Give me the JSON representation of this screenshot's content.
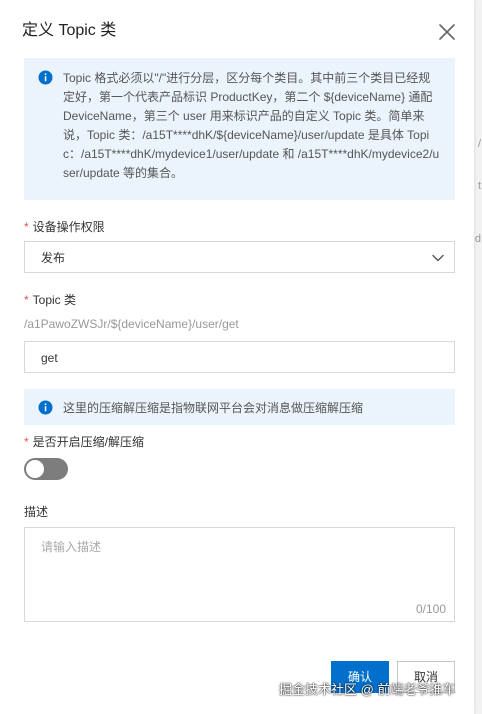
{
  "dialog": {
    "title": "定义 Topic 类"
  },
  "info_top": {
    "text": "Topic 格式必须以\"/\"进行分层，区分每个类目。其中前三个类目已经规定好，第一个代表产品标识 ProductKey，第二个 ${deviceName} 通配 DeviceName，第三个 user 用来标识产品的自定义 Topic 类。简单来说，Topic 类：/a15T****dhK/${deviceName}/user/update 是具体 Topic：/a15T****dhK/mydevice1/user/update 和 /a15T****dhK/mydevice2/user/update 等的集合。"
  },
  "permission": {
    "required_mark": "*",
    "label": "设备操作权限",
    "value": "发布"
  },
  "topic": {
    "required_mark": "*",
    "label": "Topic 类",
    "prefix_hint": "/a1PawoZWSJr/${deviceName}/user/get",
    "value": "get"
  },
  "info_mid": {
    "text": "这里的压缩解压缩是指物联网平台会对消息做压缩解压缩"
  },
  "compression": {
    "required_mark": "*",
    "label": "是否开启压缩/解压缩",
    "enabled": false
  },
  "description": {
    "label": "描述",
    "placeholder": "请输入描述",
    "counter": "0/100"
  },
  "footer": {
    "confirm_label": "确认",
    "cancel_label": "取消"
  },
  "watermark": {
    "text": "掘金技术社区 @ 前端老爷推车"
  },
  "background": {
    "glyph_1": "/",
    "glyph_2": "t",
    "glyph_3": "d"
  },
  "colors": {
    "primary": "#0070cc",
    "info_bg": "#ebf4fd",
    "info_icon": "#0070cc",
    "required": "#e8524a",
    "toggle_off": "#7d7d7d"
  },
  "icons": {
    "close": "close-icon",
    "info": "info-icon",
    "dropdown": "chevron-down-icon"
  }
}
